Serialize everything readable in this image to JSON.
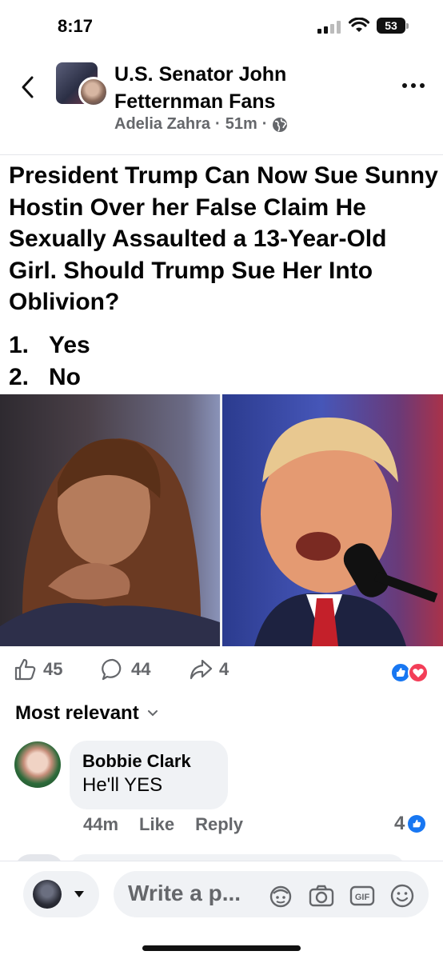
{
  "status_bar": {
    "time": "8:17",
    "battery": "53"
  },
  "header": {
    "group_name": "U.S. Senator John Fetternman Fans",
    "author": "Adelia Zahra",
    "time": "51m",
    "separator": "·"
  },
  "post": {
    "title": "President Trump Can Now Sue Sunny Hostin Over her False Claim He Sexually Assaulted a 13-Year-Old Girl. Should Trump Sue Her Into Oblivion?",
    "options": [
      {
        "num": "1.",
        "label": "Yes"
      },
      {
        "num": "2.",
        "label": "No"
      }
    ]
  },
  "actions": {
    "likes": "45",
    "comments": "44",
    "shares": "4"
  },
  "comments_section": {
    "sort_label": "Most relevant"
  },
  "comment": {
    "author": "Bobbie Clark",
    "text": "He'll YES",
    "time": "44m",
    "like_label": "Like",
    "reply_label": "Reply",
    "like_count": "4"
  },
  "composer": {
    "placeholder": "Write a p..."
  },
  "colors": {
    "brand_blue": "#1877f2",
    "love_red": "#f33e58",
    "muted_text": "#65676b"
  }
}
